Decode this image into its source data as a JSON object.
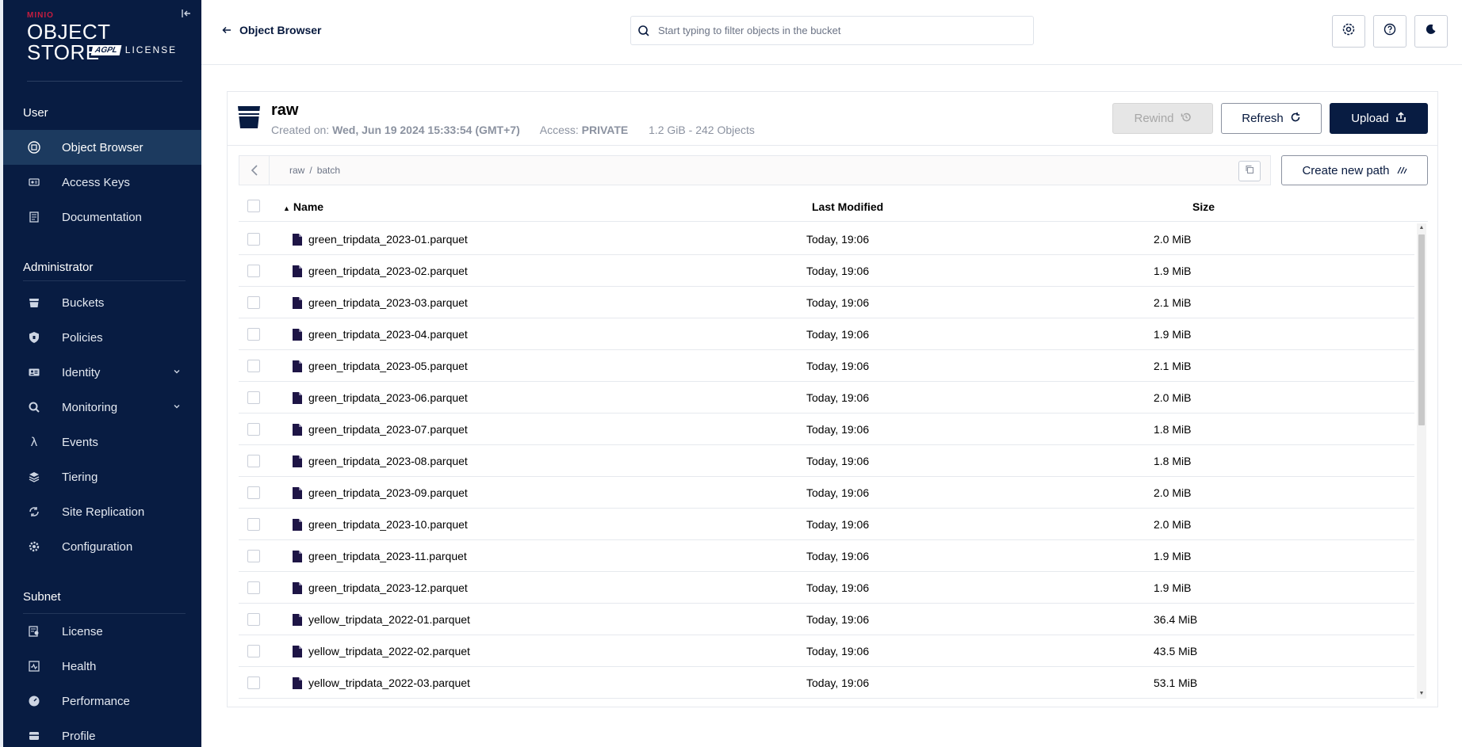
{
  "brand": {
    "top": "MINIO",
    "product": "OBJECT STORE",
    "license_badge": "AGPL",
    "license_text": "LICENSE"
  },
  "sidebar": {
    "sections": [
      {
        "title": "User"
      },
      {
        "title": "Administrator"
      },
      {
        "title": "Subnet"
      }
    ],
    "user_items": [
      {
        "label": "Object Browser",
        "icon": "object-browser-icon",
        "active": true
      },
      {
        "label": "Access Keys",
        "icon": "access-keys-icon"
      },
      {
        "label": "Documentation",
        "icon": "documentation-icon"
      }
    ],
    "admin_items": [
      {
        "label": "Buckets",
        "icon": "bucket-icon"
      },
      {
        "label": "Policies",
        "icon": "policy-shield-icon"
      },
      {
        "label": "Identity",
        "icon": "identity-card-icon",
        "expandable": true
      },
      {
        "label": "Monitoring",
        "icon": "monitoring-magnifier-icon",
        "expandable": true
      },
      {
        "label": "Events",
        "icon": "lambda-icon"
      },
      {
        "label": "Tiering",
        "icon": "tiering-layers-icon"
      },
      {
        "label": "Site Replication",
        "icon": "replication-icon"
      },
      {
        "label": "Configuration",
        "icon": "gear-icon"
      }
    ],
    "subnet_items": [
      {
        "label": "License",
        "icon": "license-icon"
      },
      {
        "label": "Health",
        "icon": "health-icon"
      },
      {
        "label": "Performance",
        "icon": "performance-gauge-icon"
      },
      {
        "label": "Profile",
        "icon": "profile-icon"
      }
    ]
  },
  "topbar": {
    "back_label": "Object Browser",
    "search_placeholder": "Start typing to filter objects in the bucket"
  },
  "bucket": {
    "name": "raw",
    "created_label": "Created on:",
    "created_value": "Wed, Jun 19 2024 15:33:54 (GMT+7)",
    "access_label": "Access:",
    "access_value": "PRIVATE",
    "usage": "1.2 GiB - 242 Objects",
    "rewind_label": "Rewind",
    "refresh_label": "Refresh",
    "upload_label": "Upload",
    "new_path_label": "Create new path"
  },
  "breadcrumb": [
    "raw",
    "/",
    "batch"
  ],
  "table": {
    "columns": {
      "name": "Name",
      "modified": "Last Modified",
      "size": "Size"
    },
    "sort": "name-ascending",
    "rows": [
      {
        "name": "green_tripdata_2023-01.parquet",
        "modified": "Today, 19:06",
        "size": "2.0 MiB"
      },
      {
        "name": "green_tripdata_2023-02.parquet",
        "modified": "Today, 19:06",
        "size": "1.9 MiB"
      },
      {
        "name": "green_tripdata_2023-03.parquet",
        "modified": "Today, 19:06",
        "size": "2.1 MiB"
      },
      {
        "name": "green_tripdata_2023-04.parquet",
        "modified": "Today, 19:06",
        "size": "1.9 MiB"
      },
      {
        "name": "green_tripdata_2023-05.parquet",
        "modified": "Today, 19:06",
        "size": "2.1 MiB"
      },
      {
        "name": "green_tripdata_2023-06.parquet",
        "modified": "Today, 19:06",
        "size": "2.0 MiB"
      },
      {
        "name": "green_tripdata_2023-07.parquet",
        "modified": "Today, 19:06",
        "size": "1.8 MiB"
      },
      {
        "name": "green_tripdata_2023-08.parquet",
        "modified": "Today, 19:06",
        "size": "1.8 MiB"
      },
      {
        "name": "green_tripdata_2023-09.parquet",
        "modified": "Today, 19:06",
        "size": "2.0 MiB"
      },
      {
        "name": "green_tripdata_2023-10.parquet",
        "modified": "Today, 19:06",
        "size": "2.0 MiB"
      },
      {
        "name": "green_tripdata_2023-11.parquet",
        "modified": "Today, 19:06",
        "size": "1.9 MiB"
      },
      {
        "name": "green_tripdata_2023-12.parquet",
        "modified": "Today, 19:06",
        "size": "1.9 MiB"
      },
      {
        "name": "yellow_tripdata_2022-01.parquet",
        "modified": "Today, 19:06",
        "size": "36.4 MiB"
      },
      {
        "name": "yellow_tripdata_2022-02.parquet",
        "modified": "Today, 19:06",
        "size": "43.5 MiB"
      },
      {
        "name": "yellow_tripdata_2022-03.parquet",
        "modified": "Today, 19:06",
        "size": "53.1 MiB"
      }
    ]
  },
  "colors": {
    "sidebar_bg": "#081c42",
    "sidebar_active": "#1c3a5f",
    "primary": "#081c42",
    "brand_red": "#c51c3f",
    "file_icon": "#1e1546"
  }
}
